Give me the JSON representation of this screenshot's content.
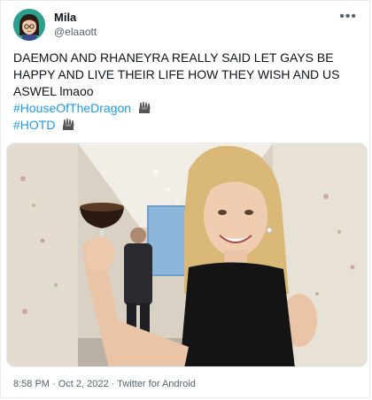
{
  "user": {
    "display_name": "Mila",
    "handle": "@elaaott",
    "avatar_icon": "avatar-cartoon-girl-icon"
  },
  "more_icon": "more-options-icon",
  "tweet": {
    "text": "DAEMON AND RHANEYRA REALLY SAID LET GAYS BE HAPPY AND LIVE THEIR LIFE HOW THEY WISH AND US ASWEL lmaoo",
    "hashtags": [
      "#HouseOfTheDragon",
      "#HOTD"
    ],
    "hashtag_emoji_icon": "iron-throne-icon"
  },
  "footer": {
    "time": "8:58 PM",
    "date": "Oct 2, 2022",
    "source": "Twitter for Android",
    "separator": " · "
  },
  "colors": {
    "link": "#1d9bf0",
    "secondary_text": "#536471",
    "avatar_bg": "#2d9f8e"
  }
}
